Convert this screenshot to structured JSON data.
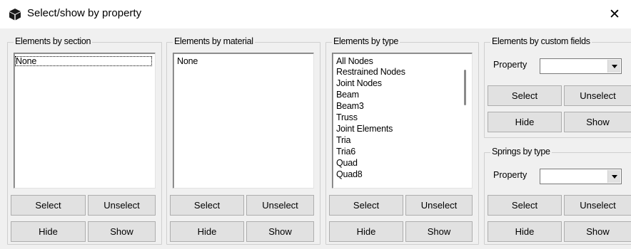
{
  "window": {
    "title": "Select/show by property",
    "close_glyph": "✕"
  },
  "section_panel": {
    "legend": "Elements by section",
    "items": [
      "None"
    ],
    "select_label": "Select",
    "unselect_label": "Unselect",
    "hide_label": "Hide",
    "show_label": "Show"
  },
  "material_panel": {
    "legend": "Elements by material",
    "items": [
      "None"
    ],
    "select_label": "Select",
    "unselect_label": "Unselect",
    "hide_label": "Hide",
    "show_label": "Show"
  },
  "type_panel": {
    "legend": "Elements by type",
    "items": [
      "All Nodes",
      "Restrained Nodes",
      "Joint Nodes",
      "Beam",
      "Beam3",
      "Truss",
      "Joint Elements",
      "Tria",
      "Tria6",
      "Quad",
      "Quad8"
    ],
    "select_label": "Select",
    "unselect_label": "Unselect",
    "hide_label": "Hide",
    "show_label": "Show"
  },
  "custom_panel": {
    "legend": "Elements by custom fields",
    "property_label": "Property",
    "property_value": "",
    "select_label": "Select",
    "unselect_label": "Unselect",
    "hide_label": "Hide",
    "show_label": "Show"
  },
  "springs_panel": {
    "legend": "Springs by type",
    "property_label": "Property",
    "property_value": "",
    "select_label": "Select",
    "unselect_label": "Unselect",
    "hide_label": "Hide",
    "show_label": "Show"
  }
}
